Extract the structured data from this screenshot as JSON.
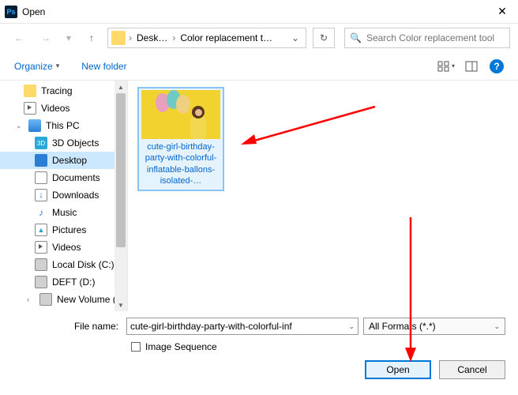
{
  "window": {
    "title": "Open",
    "close_glyph": "✕"
  },
  "nav": {
    "back_glyph": "←",
    "fwd_glyph": "→",
    "chev_glyph": "▾",
    "up_glyph": "↑"
  },
  "address": {
    "parts": [
      "Desk…",
      "Color replacement t…"
    ],
    "chev": "›",
    "dd": "⌄",
    "refresh": "↻"
  },
  "search": {
    "placeholder": "Search Color replacement tool",
    "icon": "🔍"
  },
  "toolbar": {
    "organize": "Organize",
    "organize_chev": "▾",
    "newfolder": "New folder",
    "help": "?"
  },
  "sidebar": {
    "items": [
      {
        "label": "Tracing",
        "icon": "folder",
        "level": 1
      },
      {
        "label": "Videos",
        "icon": "video",
        "level": 1
      },
      {
        "label": "This PC",
        "icon": "thispc",
        "level": 0,
        "expandable": true
      },
      {
        "label": "3D Objects",
        "icon": "3d",
        "level": 2
      },
      {
        "label": "Desktop",
        "icon": "desktop",
        "level": 2,
        "selected": true
      },
      {
        "label": "Documents",
        "icon": "doc",
        "level": 2
      },
      {
        "label": "Downloads",
        "icon": "down",
        "level": 2
      },
      {
        "label": "Music",
        "icon": "music",
        "level": 2
      },
      {
        "label": "Pictures",
        "icon": "pic",
        "level": 2
      },
      {
        "label": "Videos",
        "icon": "video",
        "level": 2
      },
      {
        "label": "Local Disk (C:)",
        "icon": "disk",
        "level": 2
      },
      {
        "label": "DEFT (D:)",
        "icon": "disk",
        "level": 2
      },
      {
        "label": "New Volume (F",
        "icon": "disk",
        "level": 2,
        "expandable": true
      }
    ]
  },
  "content": {
    "thumb_label": "cute-girl-birthday-party-with-colorful-inflatable-ballons-isolated-…"
  },
  "footer": {
    "fn_label": "File name:",
    "fn_value": "cute-girl-birthday-party-with-colorful-inf",
    "format": "All Formats (*.*)",
    "seq_label": "Image Sequence",
    "open": "Open",
    "cancel": "Cancel"
  }
}
